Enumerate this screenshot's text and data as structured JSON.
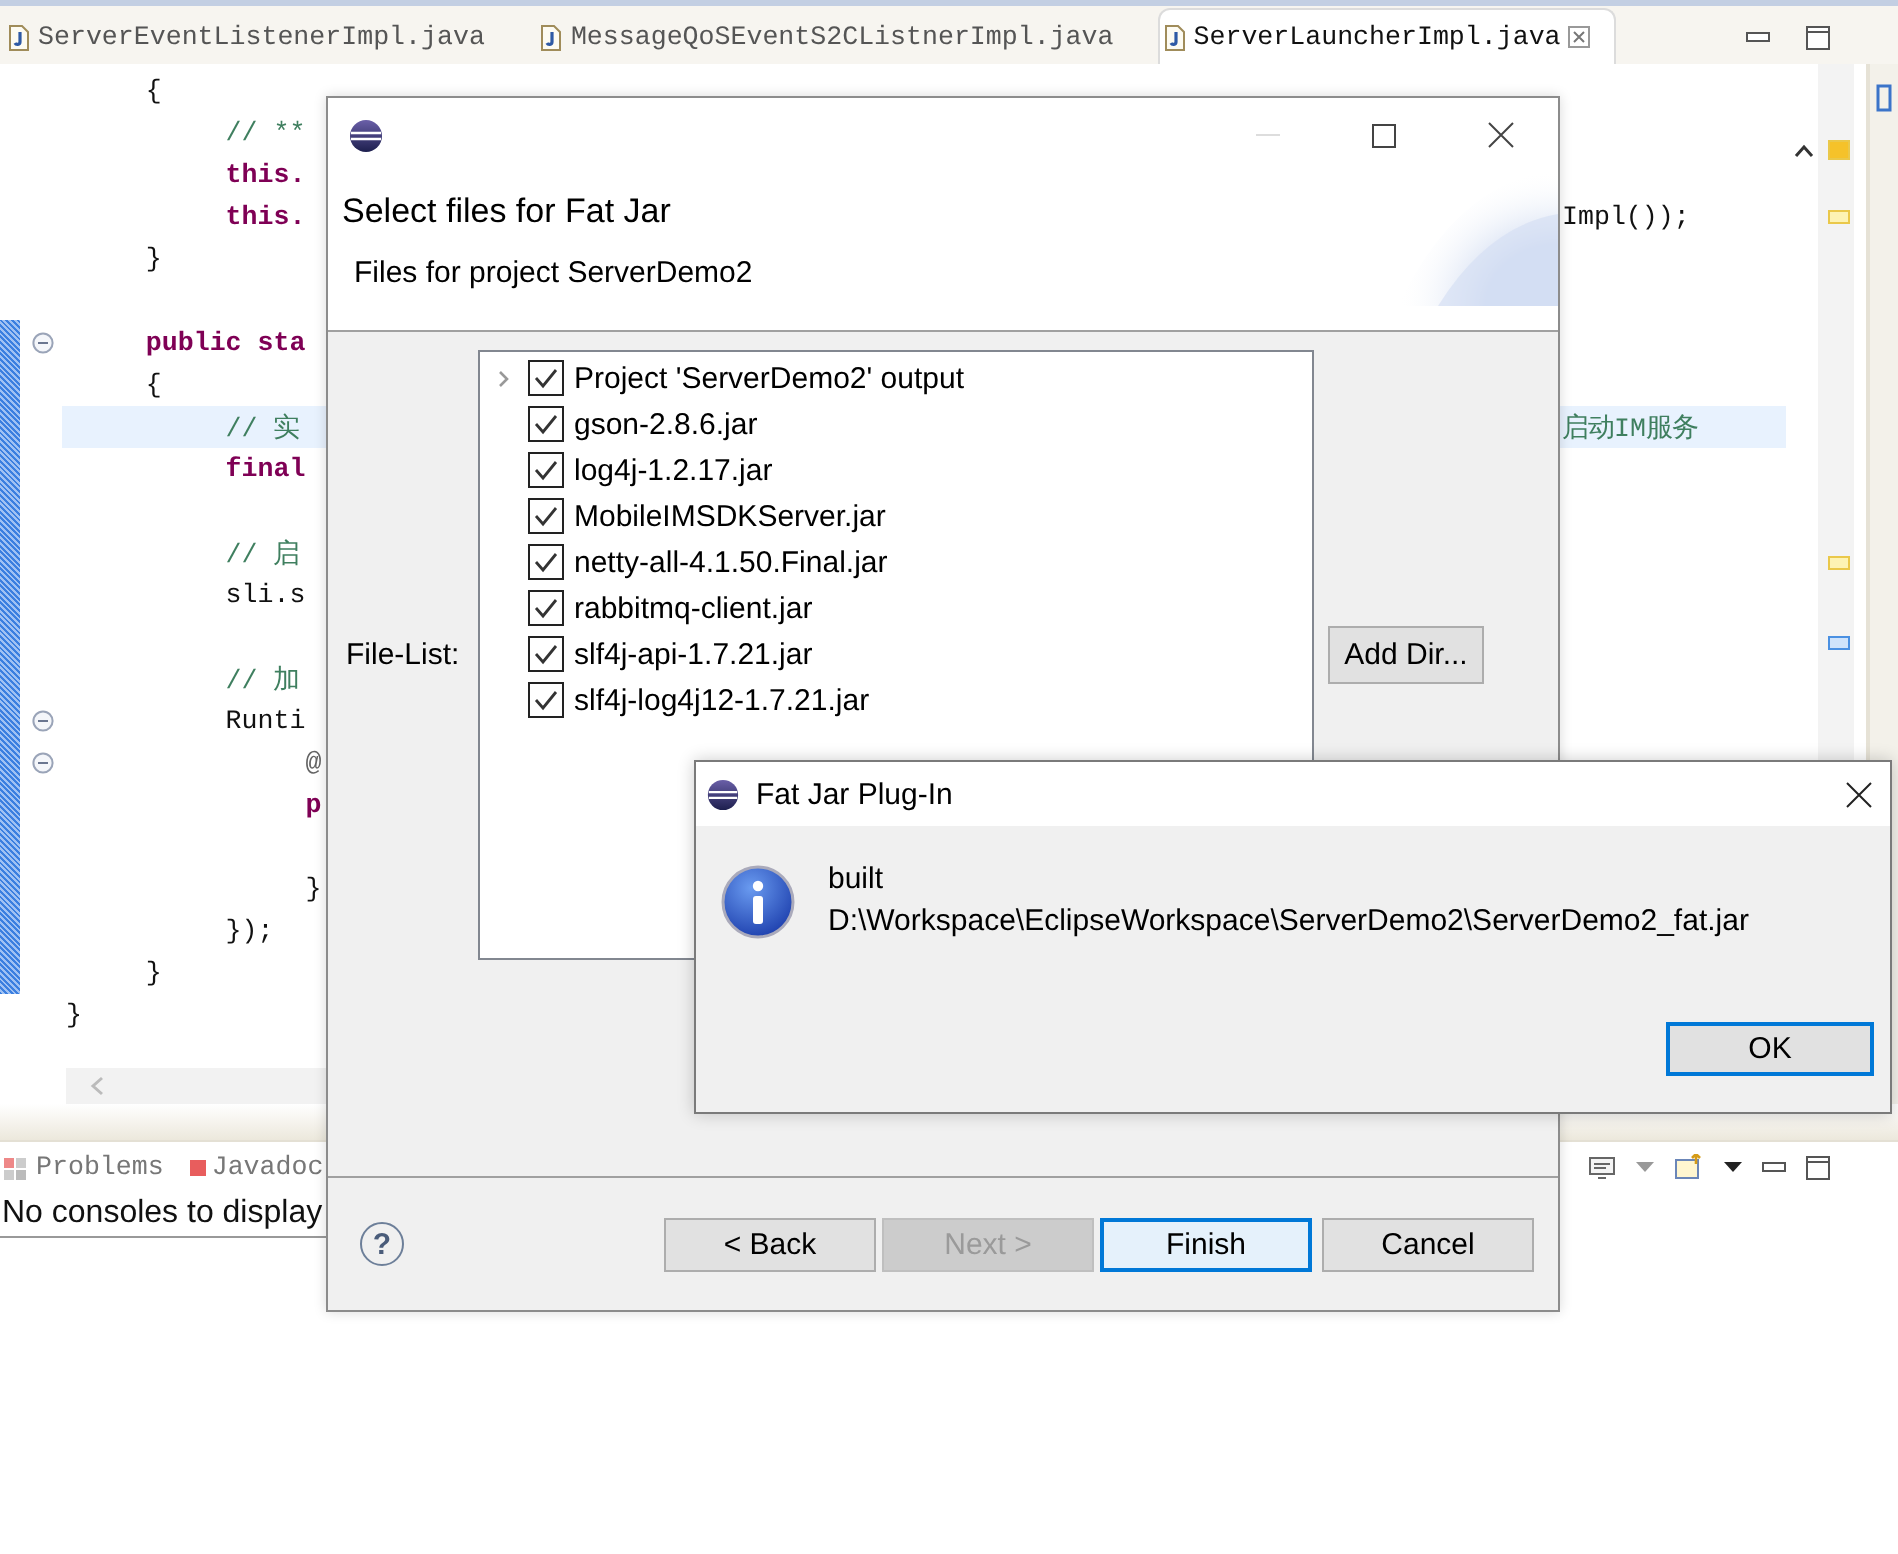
{
  "editor_tabs": [
    {
      "label": "ServerEventListenerImpl.java",
      "selected": false
    },
    {
      "label": "MessageQoSEventS2CListnerImpl.java",
      "selected": false
    },
    {
      "label": "ServerLauncherImpl.java",
      "selected": true
    }
  ],
  "code_lines": [
    {
      "kind": "plain",
      "text": "     {",
      "fold": false,
      "highlighted": false
    },
    {
      "kind": "comment",
      "text": "          // **",
      "fold": false,
      "highlighted": false
    },
    {
      "kind": "keyword",
      "text": "          this.",
      "fold": false,
      "highlighted": false
    },
    {
      "kind": "keyword",
      "text": "          this.",
      "right": {
        "kind": "plain",
        "text": "Impl());"
      },
      "fold": false,
      "highlighted": false
    },
    {
      "kind": "plain",
      "text": "     }",
      "fold": false,
      "highlighted": false
    },
    {
      "kind": "blank",
      "fold": false,
      "highlighted": false
    },
    {
      "kind": "keyword",
      "text": "     public sta",
      "fold": true,
      "highlighted": false
    },
    {
      "kind": "plain",
      "text": "     {",
      "fold": false,
      "highlighted": false
    },
    {
      "kind": "comment",
      "text": "          // 实",
      "right": {
        "kind": "comment",
        "text": "启动IM服务"
      },
      "fold": false,
      "highlighted": true
    },
    {
      "kind": "keyword",
      "text": "          final",
      "fold": false,
      "highlighted": false
    },
    {
      "kind": "blank",
      "fold": false,
      "highlighted": false
    },
    {
      "kind": "comment",
      "text": "          // 启",
      "fold": false,
      "highlighted": false
    },
    {
      "kind": "plain",
      "text": "          sli.s",
      "fold": false,
      "highlighted": false
    },
    {
      "kind": "blank",
      "fold": false,
      "highlighted": false
    },
    {
      "kind": "comment",
      "text": "          // 加",
      "fold": false,
      "highlighted": false
    },
    {
      "kind": "plain",
      "text": "          Runti",
      "fold": true,
      "highlighted": false
    },
    {
      "kind": "annotation",
      "text": "               @",
      "fold": true,
      "highlighted": false
    },
    {
      "kind": "keyword",
      "text": "               p",
      "fold": false,
      "highlighted": false
    },
    {
      "kind": "blank",
      "fold": false,
      "highlighted": false
    },
    {
      "kind": "plain",
      "text": "               }",
      "fold": false,
      "highlighted": false
    },
    {
      "kind": "plain",
      "text": "          });",
      "fold": false,
      "highlighted": false
    },
    {
      "kind": "plain",
      "text": "     }",
      "fold": false,
      "highlighted": false
    },
    {
      "kind": "plain",
      "text": "}",
      "fold": false,
      "highlighted": false
    }
  ],
  "console_panel": {
    "tabs": [
      "Problems",
      "Javadoc"
    ],
    "message": "No consoles to display"
  },
  "wizard": {
    "title": "Select files for Fat Jar",
    "subtitle": "Files for project ServerDemo2",
    "file_list_label": "File-List:",
    "files": [
      {
        "label": "Project 'ServerDemo2' output",
        "checked": true,
        "expandable": true
      },
      {
        "label": "gson-2.8.6.jar",
        "checked": true,
        "expandable": false
      },
      {
        "label": "log4j-1.2.17.jar",
        "checked": true,
        "expandable": false
      },
      {
        "label": "MobileIMSDKServer.jar",
        "checked": true,
        "expandable": false
      },
      {
        "label": "netty-all-4.1.50.Final.jar",
        "checked": true,
        "expandable": false
      },
      {
        "label": "rabbitmq-client.jar",
        "checked": true,
        "expandable": false
      },
      {
        "label": "slf4j-api-1.7.21.jar",
        "checked": true,
        "expandable": false
      },
      {
        "label": "slf4j-log4j12-1.7.21.jar",
        "checked": true,
        "expandable": false
      }
    ],
    "add_dir_button": "Add Dir...",
    "help_glyph": "?",
    "buttons": [
      {
        "label": "< Back",
        "disabled": false,
        "default": false
      },
      {
        "label": "Next >",
        "disabled": true,
        "default": false
      },
      {
        "label": "Finish",
        "disabled": false,
        "default": true
      },
      {
        "label": "Cancel",
        "disabled": false,
        "default": false
      }
    ]
  },
  "message_dialog": {
    "title": "Fat Jar Plug-In",
    "lines": [
      "built",
      "D:\\Workspace\\EclipseWorkspace\\ServerDemo2\\ServerDemo2_fat.jar"
    ],
    "ok_button": "OK"
  }
}
